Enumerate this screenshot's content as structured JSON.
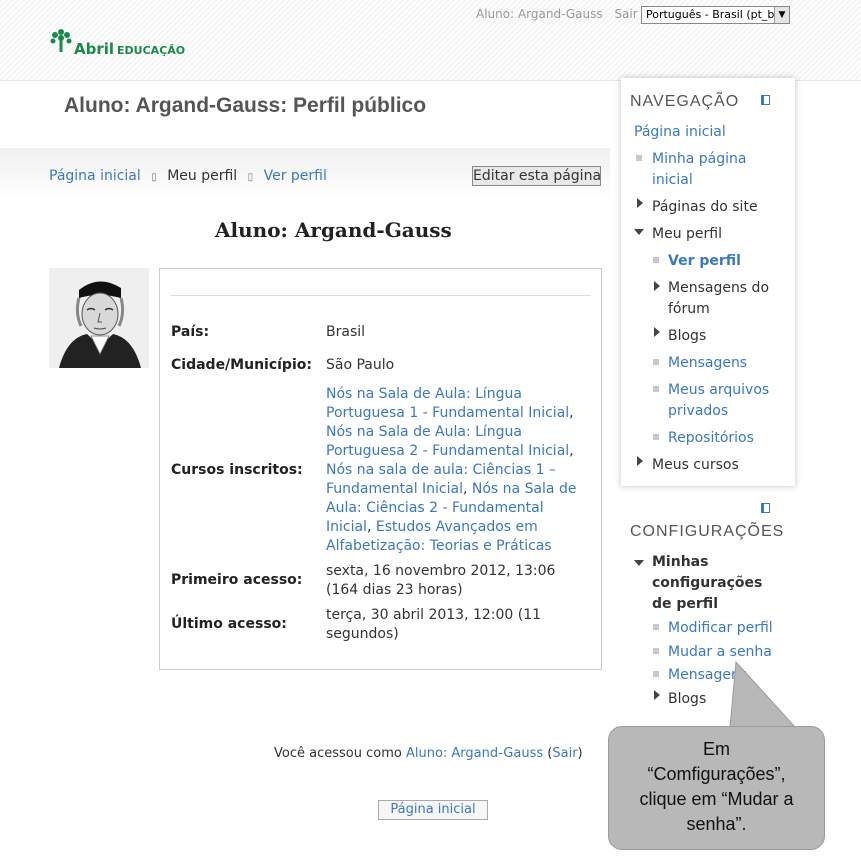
{
  "header": {
    "user_label": "Aluno: Argand-Gauss",
    "logout": "Sair",
    "language": "Português - Brasil (pt_br)",
    "logo_brand": "Abril",
    "logo_sub": "EDUCAÇÃO",
    "brand_color": "#1a8a4a"
  },
  "page": {
    "title": "Aluno: Argand-Gauss: Perfil público",
    "edit_button": "Editar esta página"
  },
  "breadcrumb": [
    "Página inicial",
    "Meu perfil",
    "Ver perfil"
  ],
  "profile": {
    "heading": "Aluno: Argand-Gauss",
    "fields": [
      {
        "label": "País:",
        "value": "Brasil"
      },
      {
        "label": "Cidade/Município:",
        "value": "São Paulo"
      },
      {
        "label": "Cursos inscritos:"
      },
      {
        "label": "Primeiro acesso:",
        "value": "sexta, 16 novembro 2012, 13:06  (164 dias 23 horas)"
      },
      {
        "label": "Último acesso:",
        "value": "terça, 30 abril 2013, 12:00  (11 segundos)"
      }
    ],
    "courses": [
      "Nós na Sala de Aula: Língua Portuguesa 1 - Fundamental Inicial",
      "Nós na Sala de Aula: Língua Portuguesa 2 - Fundamental Inicial",
      "Nós na sala de aula: Ciências 1 – Fundamental Inicial",
      "Nós na Sala de Aula: Ciências 2 - Fundamental Inicial",
      "Estudos Avançados em Alfabetização: Teorias e Práticas"
    ]
  },
  "footer": {
    "logged_prefix": "Você acessou como",
    "user": "Aluno: Argand-Gauss",
    "logout": "Sair",
    "home_button": "Página inicial"
  },
  "navigation": {
    "title": "NAVEGAÇÃO",
    "home": "Página inicial",
    "my_home": "Minha página inicial",
    "site_pages": "Páginas do site",
    "my_profile": "Meu perfil",
    "view_profile": "Ver perfil",
    "forum_posts": "Mensagens do fórum",
    "blogs": "Blogs",
    "messages": "Mensagens",
    "private_files": "Meus arquivos privados",
    "repositories": "Repositórios",
    "my_courses": "Meus cursos"
  },
  "settings": {
    "title": "CONFIGURAÇÕES",
    "profile_settings": "Minhas configurações de perfil",
    "edit_profile": "Modificar perfil",
    "change_password": "Mudar a senha",
    "messages": "Mensagens",
    "blogs": "Blogs"
  },
  "callout": {
    "text_lines": [
      "Em",
      "“Comfigurações”,",
      "clique em “Mudar a",
      "senha”."
    ]
  }
}
